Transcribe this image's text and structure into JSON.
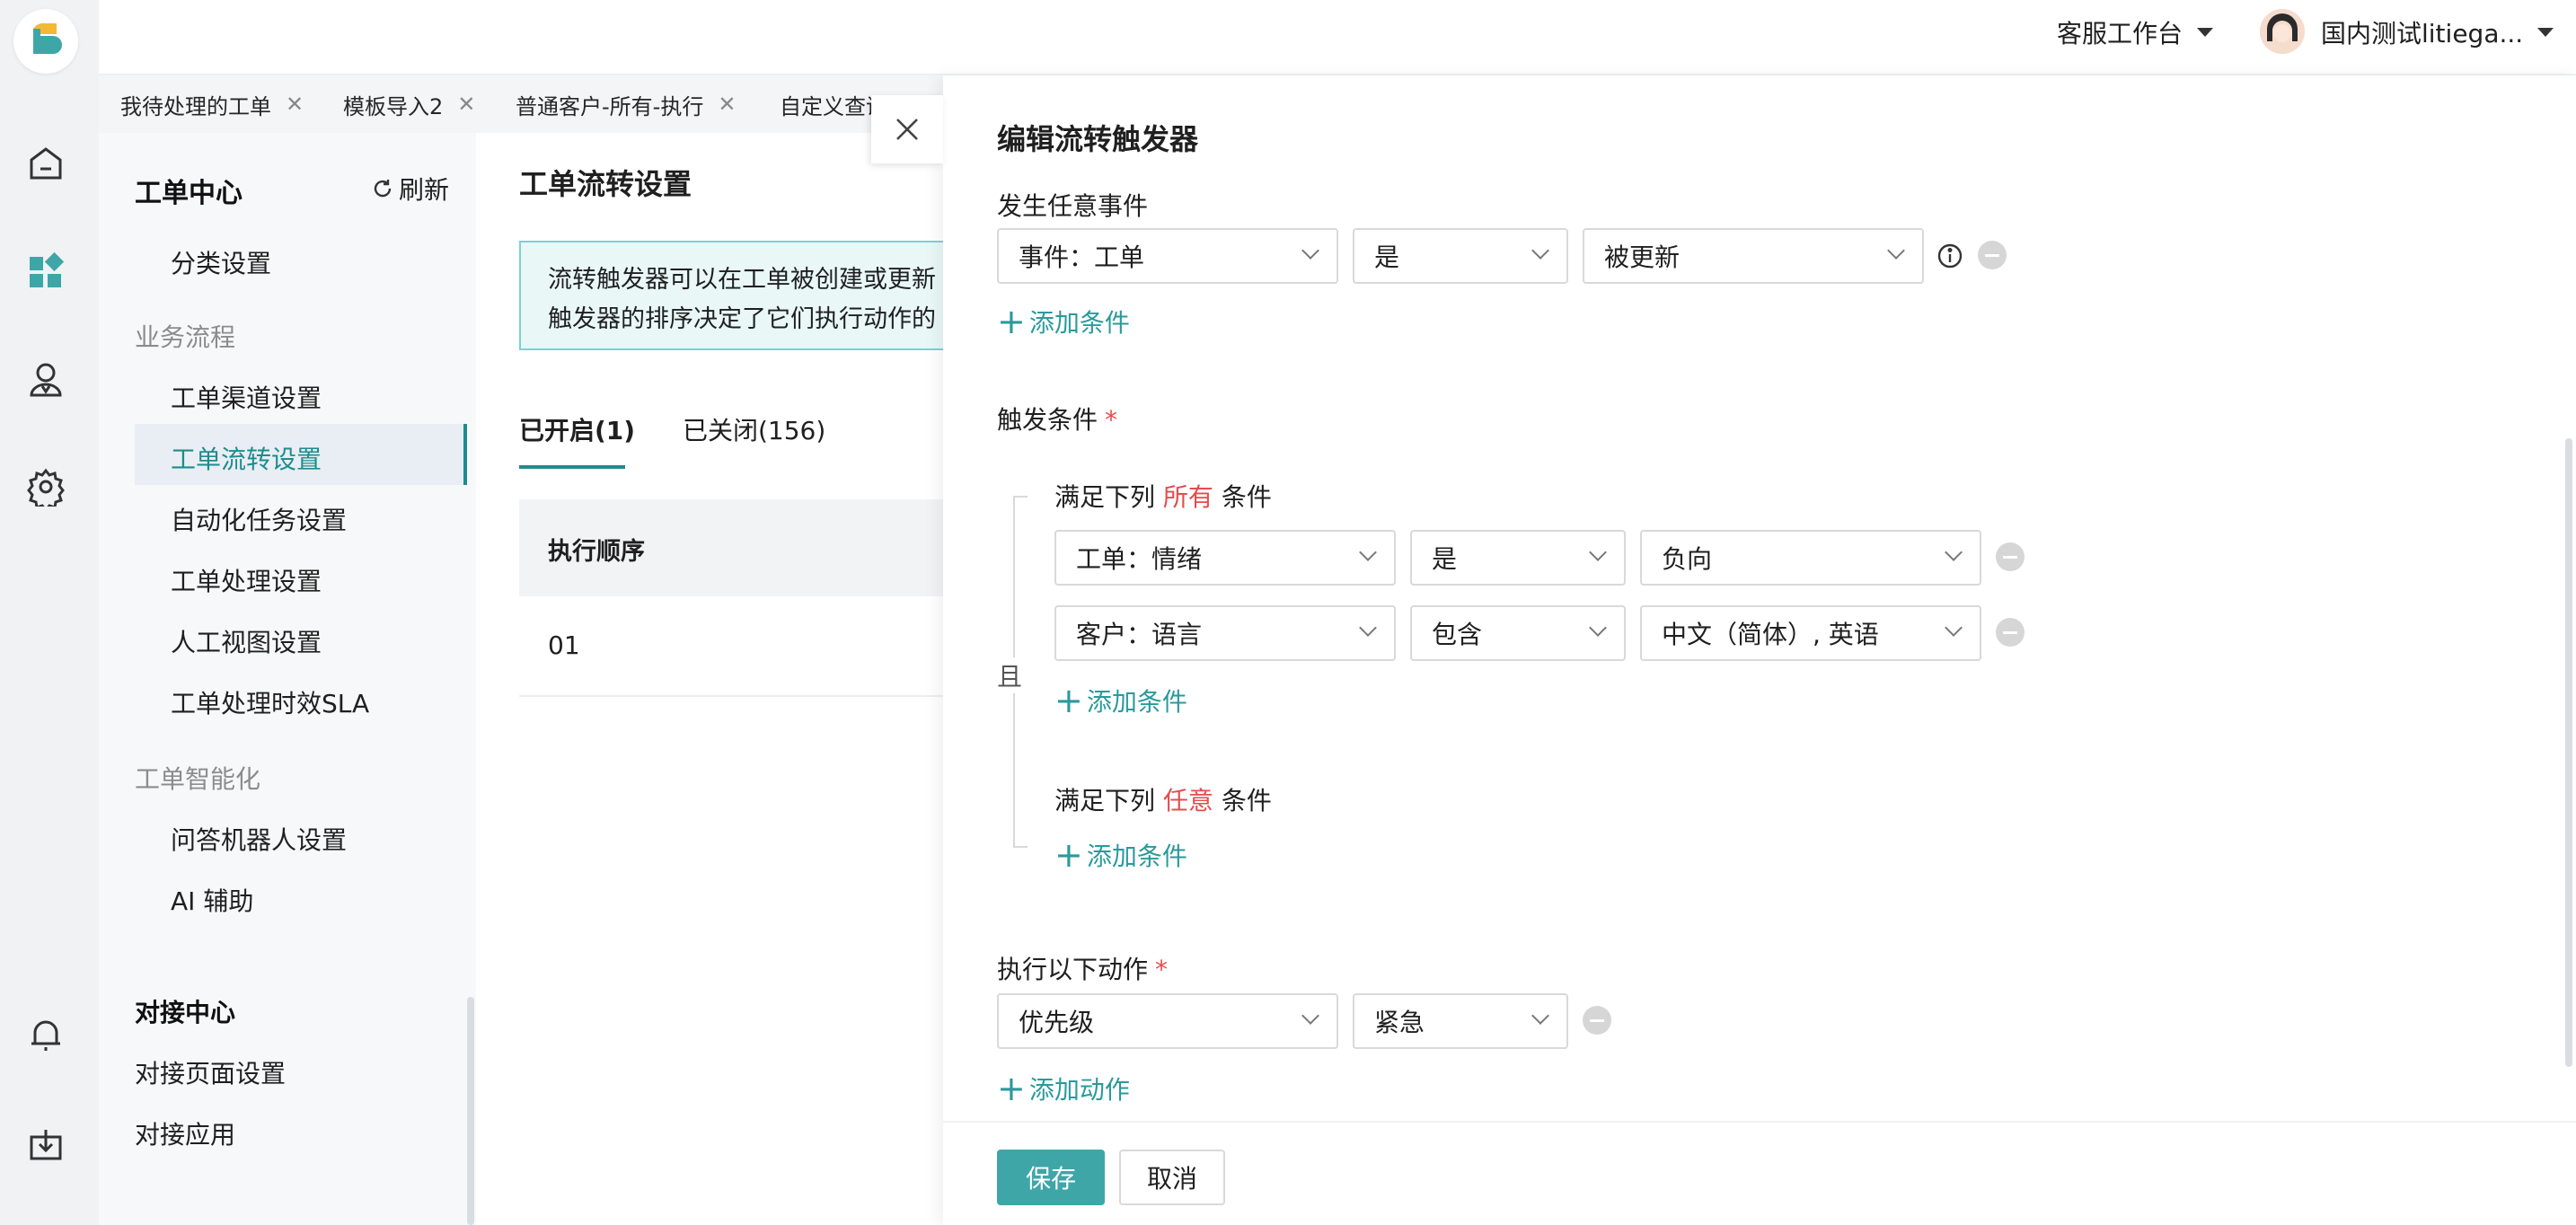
{
  "topbar": {
    "workspace_label": "客服工作台",
    "user_name": "国内测试litiega..."
  },
  "tabs": [
    {
      "label": "我待处理的工单"
    },
    {
      "label": "模板导入2"
    },
    {
      "label": "普通客户-所有-执行"
    },
    {
      "label": "自定义查询"
    }
  ],
  "rail": {
    "icons": [
      "app-logo",
      "home-icon",
      "dashboard-icon",
      "agent-icon",
      "gear-icon",
      "bell-icon",
      "download-icon"
    ]
  },
  "sidebar": {
    "title": "工单中心",
    "refresh_label": "刷新",
    "category_setting": "分类设置",
    "group_business": "业务流程",
    "items_business": [
      "工单渠道设置",
      "工单流转设置",
      "自动化任务设置",
      "工单处理设置",
      "人工视图设置",
      "工单处理时效SLA"
    ],
    "group_intel": "工单智能化",
    "items_intel": [
      "问答机器人设置",
      "AI 辅助"
    ],
    "integration_title": "对接中心",
    "items_integration": [
      "对接页面设置",
      "对接应用"
    ]
  },
  "content": {
    "title": "工单流转设置",
    "notice_line1": "流转触发器可以在工单被创建或更新",
    "notice_line2": "触发器的排序决定了它们执行动作的",
    "tab_open": "已开启(1)",
    "tab_closed": "已关闭(156)",
    "col_order": "执行顺序",
    "row_order": "01"
  },
  "drawer": {
    "title": "编辑流转触发器",
    "event_label": "发生任意事件",
    "event_select_1": "事件：工单",
    "event_select_2": "是",
    "event_select_3": "被更新",
    "add_condition": "添加条件",
    "trigger_label": "触发条件",
    "required_mark": "*",
    "and_label": "且",
    "all_prefix": "满足下列",
    "all_keyword": "所有",
    "all_suffix": "条件",
    "any_keyword": "任意",
    "cond1": {
      "field": "工单：情绪",
      "op": "是",
      "value": "负向"
    },
    "cond2": {
      "field": "客户：语言",
      "op": "包含",
      "value": "中文（简体）, 英语"
    },
    "action_label": "执行以下动作",
    "action1": {
      "field": "优先级",
      "value": "紧急"
    },
    "add_action": "添加动作",
    "save": "保存",
    "cancel": "取消"
  },
  "colors": {
    "accent": "#3fa6a8",
    "link": "#2a9a9c",
    "required": "#e34d4d",
    "notice_bg": "#e9f7f7"
  }
}
